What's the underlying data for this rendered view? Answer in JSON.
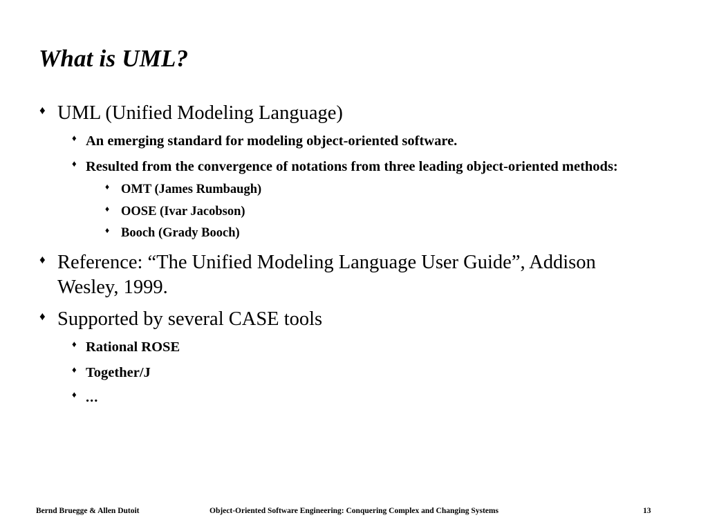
{
  "slide": {
    "title": "What is UML?",
    "background_color": "#ffffff",
    "text_color": "#000000",
    "bullet_marker": "♦",
    "content": [
      {
        "level": 1,
        "text": "UML (Unified Modeling Language)"
      },
      {
        "level": 2,
        "text": "An emerging standard for modeling object-oriented software."
      },
      {
        "level": 2,
        "text": "Resulted from the convergence of notations from three leading object-oriented methods:"
      },
      {
        "level": 3,
        "text": "OMT  (James Rumbaugh)"
      },
      {
        "level": 3,
        "text": "OOSE (Ivar Jacobson)"
      },
      {
        "level": 3,
        "text": "Booch (Grady Booch)"
      },
      {
        "level": 1,
        "text": "Reference: “The Unified Modeling Language User Guide”, Addison Wesley, 1999."
      },
      {
        "level": 1,
        "text": "Supported by several CASE tools"
      },
      {
        "level": 2,
        "text": "Rational ROSE"
      },
      {
        "level": 2,
        "text": "Together/J"
      },
      {
        "level": 2,
        "text": "..."
      }
    ]
  },
  "footer": {
    "authors": "Bernd Bruegge & Allen Dutoit",
    "book_title": "Object-Oriented Software Engineering: Conquering Complex and Changing Systems",
    "page_number": "13"
  }
}
